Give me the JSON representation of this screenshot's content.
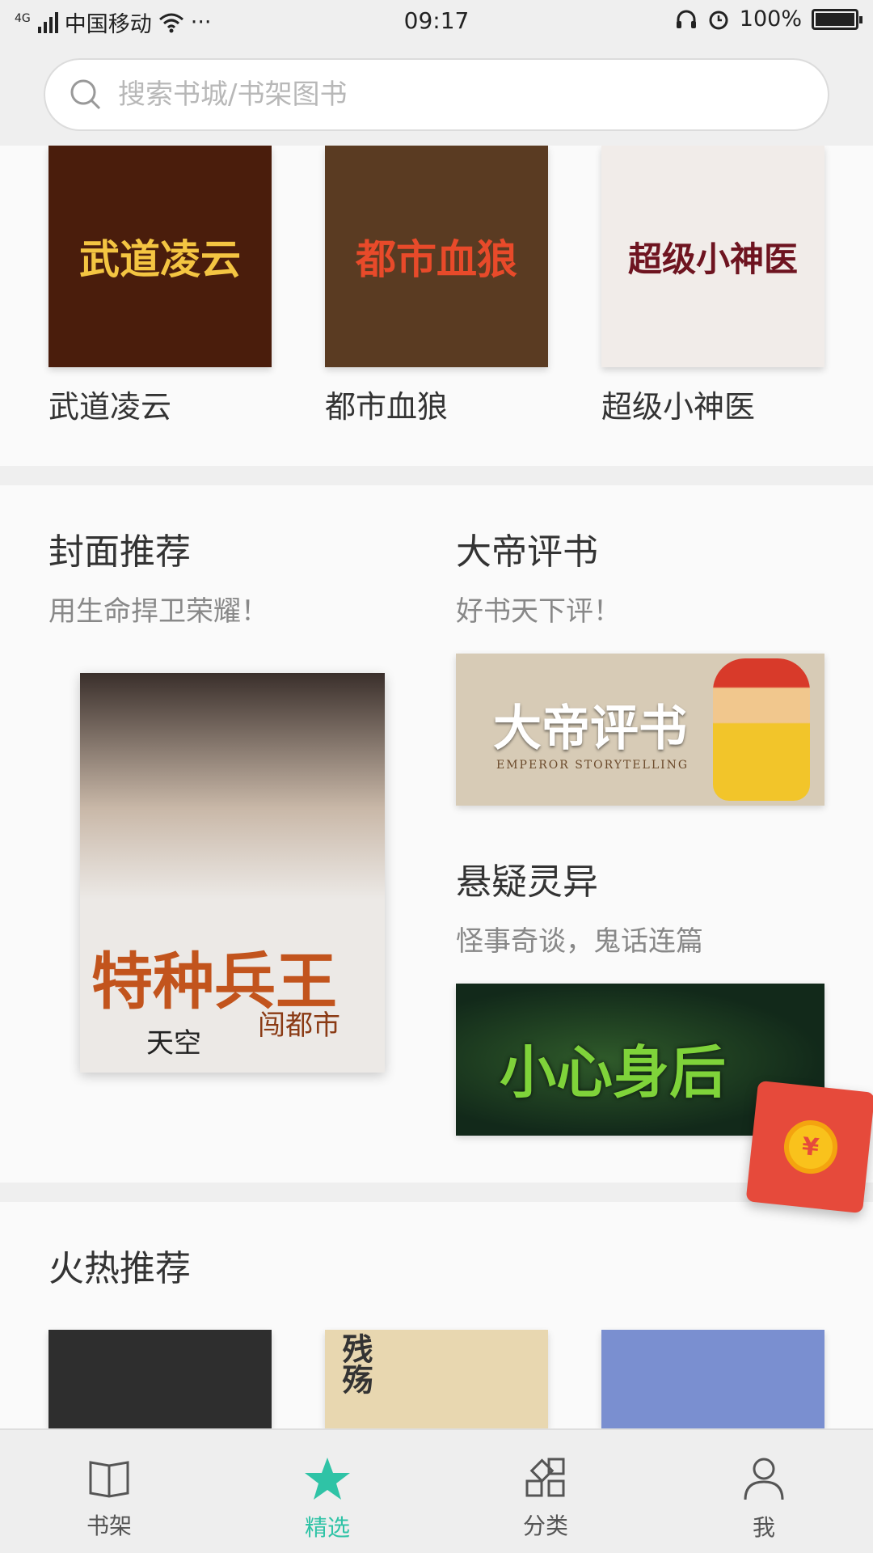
{
  "status_bar": {
    "network": "4G",
    "carrier": "中国移动",
    "more": "···",
    "time": "09:17",
    "battery_text": "100%",
    "battery_level": 1.0
  },
  "search": {
    "placeholder": "搜索书城/书架图书"
  },
  "top_books": [
    {
      "title": "武道凌云",
      "cover_text": "武道凌云",
      "bg": "#4a1d0c",
      "fg": "#f4c542"
    },
    {
      "title": "都市血狼",
      "cover_text": "都市血狼",
      "bg": "#5a3b22",
      "fg": "#e84a2a"
    },
    {
      "title": "超级小神医",
      "cover_text": "超级小神医",
      "bg": "#f1ece9",
      "fg": "#6e1420"
    }
  ],
  "cover_section": {
    "title": "封面推荐",
    "subtitle": "用生命捍卫荣耀！",
    "cover_text": "特种兵王",
    "cover_subtext": "闯都市",
    "author": "天空",
    "bg": "#ece9e6",
    "fg": "#c2541d"
  },
  "emperor_section": {
    "title": "大帝评书",
    "subtitle": "好书天下评！",
    "banner_text": "大帝评书",
    "banner_subtext": "EMPEROR STORYTELLING",
    "bg": "#d7cbb6"
  },
  "mystery_section": {
    "title": "悬疑灵异",
    "subtitle": "怪事奇谈，鬼话连篇",
    "banner_text": "小心身后",
    "bg": "#12291a",
    "fg": "#7fd33a"
  },
  "hot_section": {
    "title": "火热推荐",
    "covers": [
      {
        "bg": "#2e2e2e",
        "cover_text": ""
      },
      {
        "bg": "#e8d7b0",
        "cover_text": "残殇"
      },
      {
        "bg": "#7a8fd0",
        "cover_text": ""
      }
    ]
  },
  "red_packet": {
    "symbol": "¥"
  },
  "bottom_nav": [
    {
      "label": "书架",
      "icon": "book-icon",
      "active": false
    },
    {
      "label": "精选",
      "icon": "star-icon",
      "active": true
    },
    {
      "label": "分类",
      "icon": "category-icon",
      "active": false
    },
    {
      "label": "我",
      "icon": "user-icon",
      "active": false
    }
  ],
  "colors": {
    "accent": "#2fc3a6",
    "red_packet": "#e64a3b"
  }
}
